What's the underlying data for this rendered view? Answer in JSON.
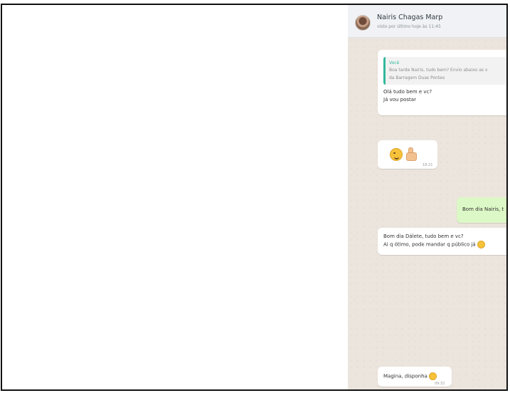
{
  "contact": {
    "name": "Nairis Chagas Marp",
    "status": "visto por último hoje às 11:45"
  },
  "messages": [
    {
      "direction": "in",
      "reply": {
        "author": "Você",
        "line1": "Boa tarde Nairis, tudo bem? Envio abaixo as v",
        "line2": "da Barragem Duas Pontes"
      },
      "line1": "Olá tudo bem e vc?",
      "line2": "Já vou postar"
    },
    {
      "direction": "in",
      "emojis": [
        "winking-face",
        "thumbs-up"
      ],
      "time": "18:21"
    },
    {
      "direction": "out",
      "text": "Bom dia Nairis, t"
    },
    {
      "direction": "in",
      "line1": "Bom dia Dálete, tudo bem e vc?",
      "line2": "Ai q ótimo, pode mandar q público já",
      "emoji": "winking-face"
    },
    {
      "direction": "in",
      "text": "Magina, disponha",
      "emoji": "kissing-face",
      "time": "09:32"
    }
  ],
  "colors": {
    "chat_bg": "#ece5dd",
    "outgoing_bubble": "#dcf8c6",
    "reply_accent": "#33b89a",
    "header_bg": "#f0f2f5"
  }
}
